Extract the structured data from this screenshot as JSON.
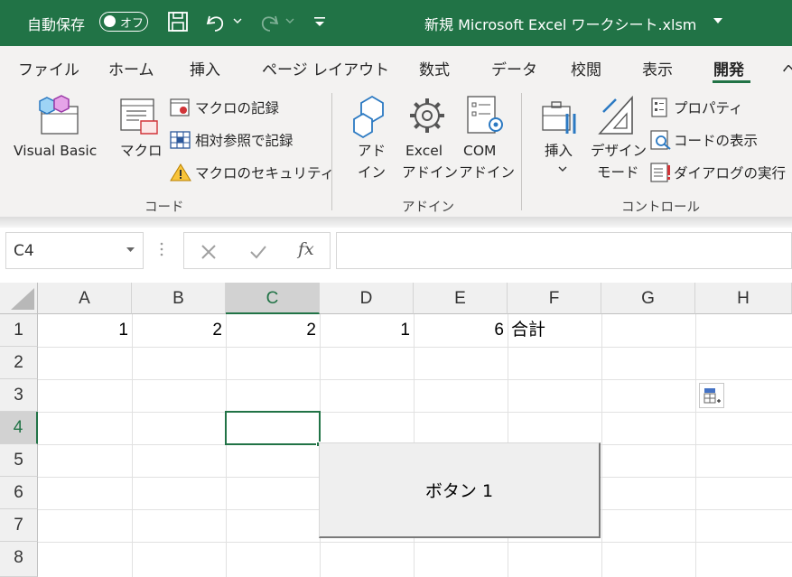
{
  "titlebar": {
    "autosave_label": "自動保存",
    "autosave_state": "オフ",
    "filename": "新規 Microsoft Excel ワークシート.xlsm"
  },
  "tabs": [
    "ファイル",
    "ホーム",
    "挿入",
    "ページ レイアウト",
    "数式",
    "データ",
    "校閲",
    "表示",
    "開発",
    "ヘ"
  ],
  "active_tab": "開発",
  "ribbon": {
    "code": {
      "visual_basic": "Visual Basic",
      "macro": "マクロ",
      "record_macro": "マクロの記録",
      "relative_ref": "相対参照で記録",
      "macro_security": "マクロのセキュリティ",
      "group_label": "コード"
    },
    "addins": {
      "addin_line1": "アド",
      "addin_line2": "イン",
      "excel_line1": "Excel",
      "excel_line2": "アドイン",
      "com_line1": "COM",
      "com_line2": "アドイン",
      "group_label": "アドイン"
    },
    "controls": {
      "insert": "挿入",
      "design_line1": "デザイン",
      "design_line2": "モード",
      "properties": "プロパティ",
      "view_code": "コードの表示",
      "run_dialog": "ダイアログの実行",
      "group_label": "コントロール"
    }
  },
  "formula_bar": {
    "name_box": "C4",
    "fx": "fx",
    "formula": ""
  },
  "grid": {
    "columns": [
      "A",
      "B",
      "C",
      "D",
      "E",
      "F",
      "G",
      "H"
    ],
    "rows": [
      "1",
      "2",
      "3",
      "4",
      "5",
      "6",
      "7",
      "8"
    ],
    "selected_cell": "C4",
    "row1": {
      "A": "1",
      "B": "2",
      "C": "2",
      "D": "1",
      "E": "6",
      "F": "合計"
    }
  },
  "form_button": {
    "label": "ボタン 1"
  },
  "colors": {
    "accent": "#217346",
    "ribbon_bg": "#f3f2f1"
  }
}
